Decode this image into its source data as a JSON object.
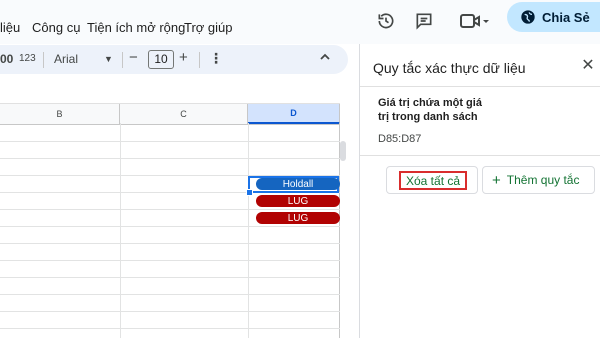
{
  "menu": {
    "items": [
      {
        "id": "data",
        "label": "liệu"
      },
      {
        "id": "tools",
        "label": "Công cụ"
      },
      {
        "id": "extensions",
        "label": "Tiện ích mở rộng"
      },
      {
        "id": "help",
        "label": "Trợ giúp"
      }
    ]
  },
  "header_icons": [
    "history-icon",
    "comment-icon",
    "video-call-icon"
  ],
  "share": {
    "label": "Chia Sẻ",
    "icon": "globe-icon"
  },
  "toolbar": {
    "format_number": "00",
    "format_123": "123",
    "font": "Arial",
    "font_size": "10",
    "minus": "−",
    "plus": "+",
    "more": "⋮"
  },
  "sheet": {
    "columns": [
      "B",
      "C",
      "D"
    ],
    "selected_column": "D",
    "chips": [
      {
        "text": "Holdall",
        "color": "#1565c0"
      },
      {
        "text": "LUG",
        "color": "#b10202"
      },
      {
        "text": "LUG",
        "color": "#b10202"
      }
    ]
  },
  "panel": {
    "title": "Quy tắc xác thực dữ liệu",
    "rule": {
      "line1": "Giá trị chứa một giá",
      "line2": "trị trong danh sách",
      "range": "D85:D87"
    },
    "clear_all": "Xóa tất cả",
    "add_rule": "Thêm quy tắc"
  }
}
